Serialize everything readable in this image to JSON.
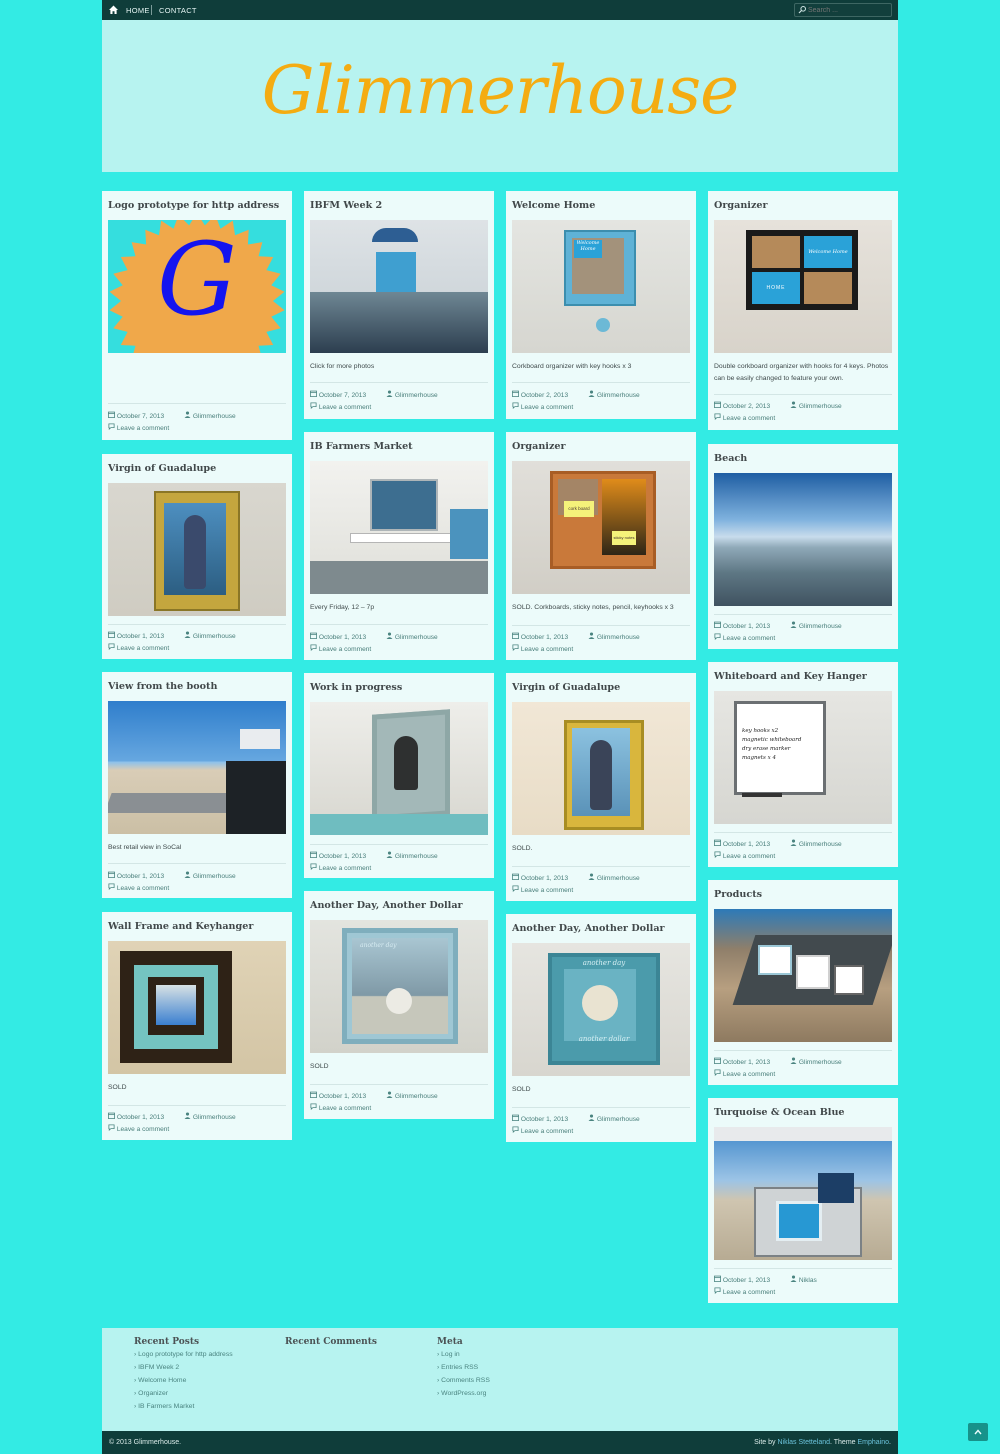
{
  "nav": {
    "home": "HOME",
    "contact": "CONTACT"
  },
  "search": {
    "placeholder": "Search ..."
  },
  "site": {
    "title": "Glimmerhouse"
  },
  "posts": [
    {
      "title": "Logo prototype for http address",
      "excerpt": "",
      "date": "October 7, 2013",
      "author": "Glimmerhouse",
      "comment": "Leave a comment"
    },
    {
      "title": "Virgin of Guadalupe",
      "excerpt": "",
      "date": "October 1, 2013",
      "author": "Glimmerhouse",
      "comment": "Leave a comment"
    },
    {
      "title": "View from the booth",
      "excerpt": "Best retail view in SoCal",
      "date": "October 1, 2013",
      "author": "Glimmerhouse",
      "comment": "Leave a comment"
    },
    {
      "title": "Wall Frame and Keyhanger",
      "excerpt": "SOLD",
      "date": "October 1, 2013",
      "author": "Glimmerhouse",
      "comment": "Leave a comment"
    },
    {
      "title": "IBFM Week 2",
      "excerpt": "Click for more photos",
      "date": "October 7, 2013",
      "author": "Glimmerhouse",
      "comment": "Leave a comment"
    },
    {
      "title": "IB Farmers Market",
      "excerpt": "Every Friday, 12 – 7p",
      "date": "October 1, 2013",
      "author": "Glimmerhouse",
      "comment": "Leave a comment"
    },
    {
      "title": "Work in progress",
      "excerpt": "",
      "date": "October 1, 2013",
      "author": "Glimmerhouse",
      "comment": "Leave a comment"
    },
    {
      "title": "Another Day, Another Dollar",
      "excerpt": "SOLD",
      "date": "October 1, 2013",
      "author": "Glimmerhouse",
      "comment": "Leave a comment"
    },
    {
      "title": "Welcome Home",
      "excerpt": "Corkboard organizer with key hooks x 3",
      "date": "October 2, 2013",
      "author": "Glimmerhouse",
      "comment": "Leave a comment"
    },
    {
      "title": "Organizer",
      "excerpt": "SOLD. Corkboards, sticky notes, pencil, keyhooks x 3",
      "date": "October 1, 2013",
      "author": "Glimmerhouse",
      "comment": "Leave a comment"
    },
    {
      "title": "Virgin of Guadalupe",
      "excerpt": "SOLD.",
      "date": "October 1, 2013",
      "author": "Glimmerhouse",
      "comment": "Leave a comment"
    },
    {
      "title": "Another Day, Another Dollar",
      "excerpt": "SOLD",
      "date": "October 1, 2013",
      "author": "Glimmerhouse",
      "comment": "Leave a comment"
    },
    {
      "title": "Organizer",
      "excerpt": "Double corkboard organizer with hooks for 4 keys. Photos can be easily changed to feature your own.",
      "date": "October 2, 2013",
      "author": "Glimmerhouse",
      "comment": "Leave a comment"
    },
    {
      "title": "Beach",
      "excerpt": "",
      "date": "October 1, 2013",
      "author": "Glimmerhouse",
      "comment": "Leave a comment"
    },
    {
      "title": "Whiteboard and Key Hanger",
      "excerpt": "",
      "date": "October 1, 2013",
      "author": "Glimmerhouse",
      "comment": "Leave a comment"
    },
    {
      "title": "Products",
      "excerpt": "",
      "date": "October 1, 2013",
      "author": "Glimmerhouse",
      "comment": "Leave a comment"
    },
    {
      "title": "Turquoise & Ocean Blue",
      "excerpt": "",
      "date": "October 1, 2013",
      "author": "Niklas",
      "comment": "Leave a comment"
    }
  ],
  "photo_text": {
    "logo_letter": "G",
    "welcome": "Welcome Home",
    "home_word": "HOME",
    "cork": "cork board",
    "sticky": "sticky notes",
    "another_day": "another day",
    "another_dollar": "another dollar",
    "wb_line1": "key hooks x2",
    "wb_line2": "magnetic whiteboard",
    "wb_line3": "dry erase marker",
    "wb_line4": "magnets x 4"
  },
  "footer": {
    "recent_posts": {
      "title": "Recent Posts",
      "items": [
        "Logo prototype for http address",
        "IBFM Week 2",
        "Welcome Home",
        "Organizer",
        "IB Farmers Market"
      ]
    },
    "recent_comments": {
      "title": "Recent Comments"
    },
    "meta": {
      "title": "Meta",
      "items": [
        "Log in",
        "Entries RSS",
        "Comments RSS",
        "WordPress.org"
      ]
    }
  },
  "bottom": {
    "copyright": "© 2013 Glimmerhouse.",
    "site_by": "Site by",
    "author_link": "Niklas Stetteland",
    "theme_label": ". Theme",
    "theme_link": "Emphaino",
    "end": "."
  },
  "colors": {
    "background": "#33ebe4",
    "header": "#b7f3f0",
    "card": "#ecfbfa",
    "bar": "#0f3d3a",
    "title": "#f4ac12"
  },
  "icons": [
    "home-icon",
    "search-icon",
    "calendar-icon",
    "user-icon",
    "comment-icon",
    "chevron-right-icon",
    "arrow-up-icon"
  ]
}
